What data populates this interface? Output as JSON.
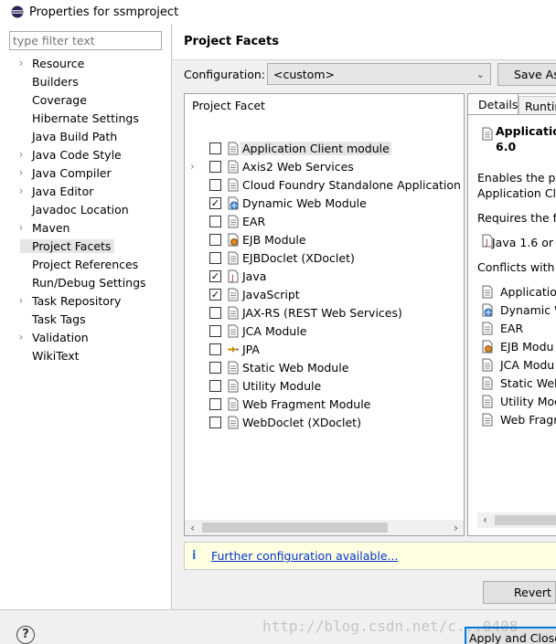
{
  "window": {
    "title": "Properties for ssmproject"
  },
  "filter": {
    "placeholder": "type filter text"
  },
  "nav": {
    "items": [
      {
        "label": "Resource",
        "expandable": true
      },
      {
        "label": "Builders",
        "expandable": false
      },
      {
        "label": "Coverage",
        "expandable": false
      },
      {
        "label": "Hibernate Settings",
        "expandable": false
      },
      {
        "label": "Java Build Path",
        "expandable": false
      },
      {
        "label": "Java Code Style",
        "expandable": true
      },
      {
        "label": "Java Compiler",
        "expandable": true
      },
      {
        "label": "Java Editor",
        "expandable": true
      },
      {
        "label": "Javadoc Location",
        "expandable": false
      },
      {
        "label": "Maven",
        "expandable": true
      },
      {
        "label": "Project Facets",
        "expandable": false,
        "selected": true
      },
      {
        "label": "Project References",
        "expandable": false
      },
      {
        "label": "Run/Debug Settings",
        "expandable": false
      },
      {
        "label": "Task Repository",
        "expandable": true
      },
      {
        "label": "Task Tags",
        "expandable": false
      },
      {
        "label": "Validation",
        "expandable": true
      },
      {
        "label": "WikiText",
        "expandable": false
      }
    ]
  },
  "page": {
    "title": "Project Facets",
    "config_label": "Configuration:",
    "config_value": "<custom>",
    "save_as": "Save As",
    "facet_header": "Project Facet",
    "facets": [
      {
        "name": "Application Client module",
        "checked": false,
        "selected": true,
        "expandable": false,
        "icon": "module-file-icon"
      },
      {
        "name": "Axis2 Web Services",
        "checked": false,
        "expandable": true,
        "icon": "module-file-icon"
      },
      {
        "name": "Cloud Foundry Standalone Application",
        "checked": false,
        "expandable": false,
        "icon": "module-file-icon"
      },
      {
        "name": "Dynamic Web Module",
        "checked": true,
        "expandable": false,
        "icon": "web-module-icon"
      },
      {
        "name": "EAR",
        "checked": false,
        "expandable": false,
        "icon": "module-file-icon"
      },
      {
        "name": "EJB Module",
        "checked": false,
        "expandable": false,
        "icon": "ejb-bean-icon"
      },
      {
        "name": "EJBDoclet (XDoclet)",
        "checked": false,
        "expandable": false,
        "icon": "module-file-icon"
      },
      {
        "name": "Java",
        "checked": true,
        "expandable": false,
        "icon": "java-file-icon"
      },
      {
        "name": "JavaScript",
        "checked": true,
        "expandable": false,
        "icon": "module-file-icon"
      },
      {
        "name": "JAX-RS (REST Web Services)",
        "checked": false,
        "expandable": false,
        "icon": "module-file-icon"
      },
      {
        "name": "JCA Module",
        "checked": false,
        "expandable": false,
        "icon": "module-file-icon"
      },
      {
        "name": "JPA",
        "checked": false,
        "expandable": false,
        "icon": "jpa-icon"
      },
      {
        "name": "Static Web Module",
        "checked": false,
        "expandable": false,
        "icon": "module-file-icon"
      },
      {
        "name": "Utility Module",
        "checked": false,
        "expandable": false,
        "icon": "module-file-icon"
      },
      {
        "name": "Web Fragment Module",
        "checked": false,
        "expandable": false,
        "icon": "module-file-icon"
      },
      {
        "name": "WebDoclet (XDoclet)",
        "checked": false,
        "expandable": false,
        "icon": "module-file-icon"
      }
    ],
    "details": {
      "tab_details": "Details",
      "tab_runtimes": "Runtim",
      "title_line1": "Application",
      "title_line2": "6.0",
      "enables_line1": "Enables the pro",
      "enables_line2": "Application Clie",
      "requires": "Requires the fo",
      "requires_item": "Java 1.6 or",
      "conflicts": "Conflicts with th",
      "conflict_items": [
        {
          "label": "Application",
          "icon": "module-file-icon"
        },
        {
          "label": "Dynamic W",
          "icon": "web-module-icon"
        },
        {
          "label": "EAR",
          "icon": "module-file-icon"
        },
        {
          "label": "EJB Modu",
          "icon": "ejb-bean-icon"
        },
        {
          "label": "JCA Modu",
          "icon": "module-file-icon"
        },
        {
          "label": "Static Web",
          "icon": "module-file-icon"
        },
        {
          "label": "Utility Mod",
          "icon": "module-file-icon"
        },
        {
          "label": "Web Fragm",
          "icon": "module-file-icon"
        }
      ]
    },
    "info_icon": "i",
    "info_link": "Further configuration available...",
    "revert": "Revert"
  },
  "footer": {
    "help": "?",
    "apply_close": "Apply and Close",
    "watermark": "http://blog.csdn.net/c...0408"
  }
}
